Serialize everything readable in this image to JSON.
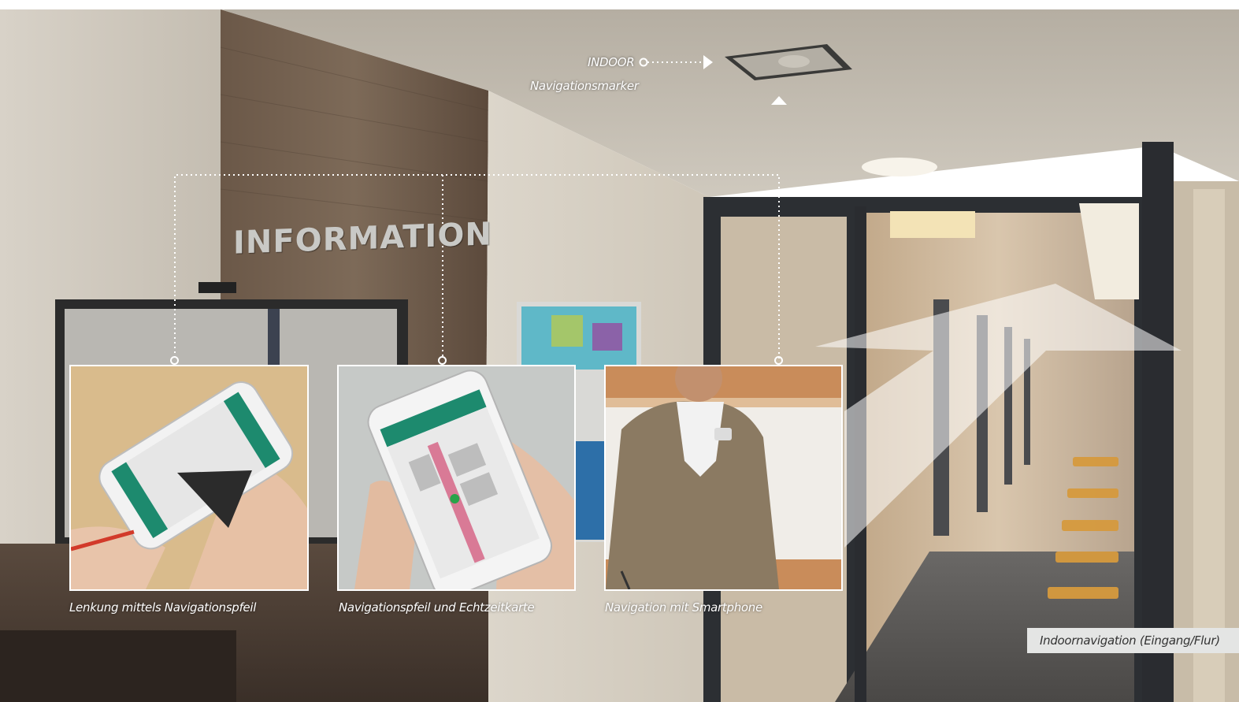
{
  "scene": {
    "sign_text": "INFORMATION"
  },
  "marker": {
    "title": "INDOOR",
    "subtitle": "Navigationsmarker"
  },
  "thumbnails": [
    {
      "caption": "Lenkung mittels Navigationspfeil"
    },
    {
      "caption": "Navigationspfeil und Echtzeitkarte"
    },
    {
      "caption": "Navigation mit Smartphone"
    }
  ],
  "area_label": "Indoornavigation (Eingang/Flur)",
  "colors": {
    "app_green": "#1d8a6e",
    "callout_line": "#ffffff",
    "label_bg": "#e4e5e4"
  }
}
